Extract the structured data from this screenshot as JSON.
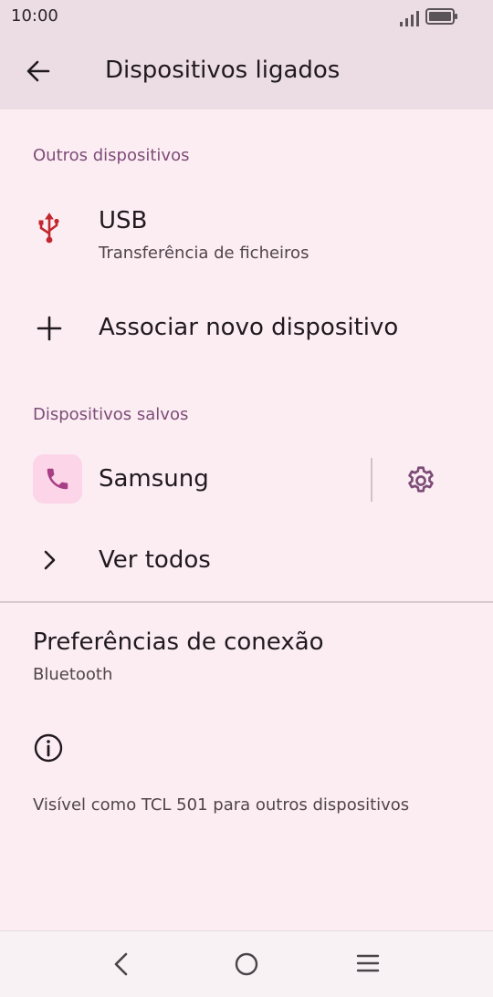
{
  "status_bar": {
    "time": "10:00",
    "signal_icon": "signal-icon",
    "battery_icon": "battery-icon"
  },
  "app_bar": {
    "back_icon": "back-arrow-icon",
    "title": "Dispositivos ligados"
  },
  "sections": {
    "other_devices": "Outros dispositivos",
    "saved_devices": "Dispositivos salvos"
  },
  "usb": {
    "title": "USB",
    "subtitle": "Transferência de ficheiros",
    "icon": "usb-icon"
  },
  "pair_new": {
    "label": "Associar novo dispositivo",
    "icon": "plus-icon"
  },
  "saved_device": {
    "name": "Samsung",
    "icon": "phone-icon",
    "settings_icon": "gear-icon"
  },
  "see_all": {
    "label": "Ver todos",
    "icon": "chevron-right-icon"
  },
  "connection_preferences": {
    "title": "Preferências de conexão",
    "subtitle": "Bluetooth"
  },
  "footer": {
    "info_icon": "info-icon",
    "visibility_text": "Visível como TCL 501 para outros dispositivos"
  },
  "nav_bar": {
    "back_icon": "nav-back-icon",
    "home_icon": "nav-home-icon",
    "recents_icon": "nav-recents-icon"
  },
  "colors": {
    "background": "#fcedf3",
    "app_bar": "#ecdde4",
    "section_header": "#7d4c77",
    "usb_icon": "#c1272d",
    "phone_tile": "#fcd5e8",
    "phone_icon": "#a83f85",
    "settings_icon": "#7d4c77"
  }
}
